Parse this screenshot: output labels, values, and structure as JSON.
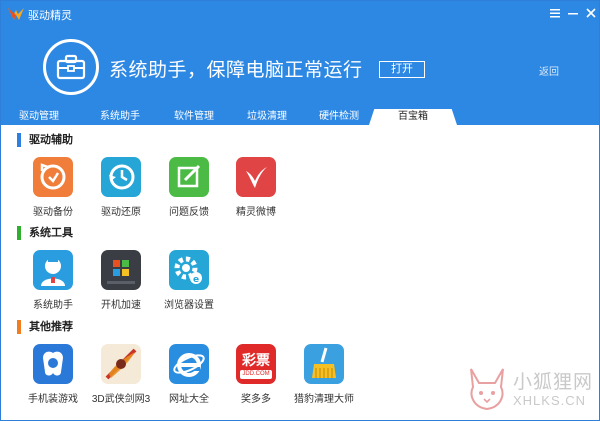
{
  "titlebar": {
    "app_title": "驱动精灵",
    "menu_icon": "menu-icon",
    "minimize_icon": "minimize-icon",
    "close_icon": "close-icon"
  },
  "hero": {
    "icon": "toolbox-icon",
    "text": "系统助手，保障电脑正常运行",
    "open_button": "打开",
    "back_link": "返回"
  },
  "tabs": [
    {
      "label": "驱动管理",
      "active": false
    },
    {
      "label": "系统助手",
      "active": false
    },
    {
      "label": "软件管理",
      "active": false
    },
    {
      "label": "垃圾清理",
      "active": false
    },
    {
      "label": "硬件检测",
      "active": false
    },
    {
      "label": "百宝箱",
      "active": true
    }
  ],
  "sections": [
    {
      "title": "驱动辅助",
      "color": "#2d7fe0",
      "apps": [
        {
          "label": "驱动备份",
          "icon": "driver-backup-icon",
          "color": "#f07d3a"
        },
        {
          "label": "驱动还原",
          "icon": "driver-restore-icon",
          "color": "#26a6d6"
        },
        {
          "label": "问题反馈",
          "icon": "feedback-icon",
          "color": "#4cbb45"
        },
        {
          "label": "精灵微博",
          "icon": "weibo-icon",
          "color": "#e04444"
        }
      ]
    },
    {
      "title": "系统工具",
      "color": "#2fae2f",
      "apps": [
        {
          "label": "系统助手",
          "icon": "system-assistant-icon",
          "color": "#2a9de0"
        },
        {
          "label": "开机加速",
          "icon": "boot-speedup-icon",
          "color": "#3a3d44"
        },
        {
          "label": "浏览器设置",
          "icon": "browser-settings-icon",
          "color": "#26a6d6"
        }
      ]
    },
    {
      "title": "其他推荐",
      "color": "#f07d20",
      "apps": [
        {
          "label": "手机装游戏",
          "icon": "phone-game-icon",
          "color": "#2a78d8"
        },
        {
          "label": "3D武侠剑网3",
          "icon": "jx3-game-icon",
          "color": "#c9352a"
        },
        {
          "label": "网址大全",
          "icon": "ie-browser-icon",
          "color": "#2a8ee0"
        },
        {
          "label": "奖多多",
          "icon": "lottery-icon",
          "color": "#e02a2a",
          "badge_text": "彩票",
          "badge_sub": "JDD.COM"
        },
        {
          "label": "猎豹清理大师",
          "icon": "cleaner-icon",
          "color": "#3aa0e0"
        }
      ]
    }
  ],
  "watermark": {
    "icon": "fox-logo-icon",
    "text_cn": "小狐狸网",
    "text_en": "XHLKS.CN"
  }
}
